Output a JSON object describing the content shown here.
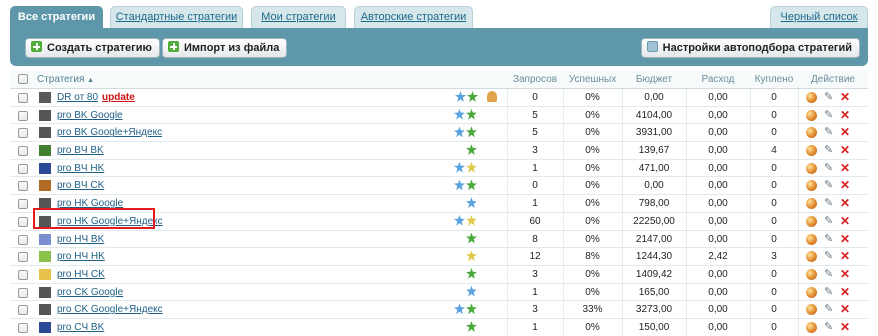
{
  "tabs": [
    {
      "label": "Все стратегии",
      "active": true
    },
    {
      "label": "Стандартные стратегии",
      "active": false
    },
    {
      "label": "Мои стратегии",
      "active": false
    },
    {
      "label": "Авторские стратегии",
      "active": false
    },
    {
      "label": "Черный список",
      "active": false
    }
  ],
  "toolbar": {
    "create_label": "Создать стратегию",
    "import_label": "Импорт из файла",
    "settings_label": "Настройки автоподбора стратегий"
  },
  "table": {
    "columns": {
      "strategy": "Стратегия",
      "requests": "Запросов",
      "success": "Успешных",
      "budget": "Бюджет",
      "expense": "Расход",
      "bought": "Куплено",
      "action": "Действие"
    },
    "sort_indicator": "▲",
    "rows": [
      {
        "color": "#5a5a5a",
        "name": "DR от 80",
        "extra": "update",
        "icons": [
          "b",
          "g",
          "person"
        ],
        "requests": "0",
        "success": "0%",
        "budget": "0,00",
        "expense": "0,00",
        "bought": "0"
      },
      {
        "color": "#555555",
        "name": "pro BK Google",
        "icons": [
          "b",
          "g"
        ],
        "requests": "5",
        "success": "0%",
        "budget": "4104,00",
        "expense": "0,00",
        "bought": "0"
      },
      {
        "color": "#555555",
        "name": "pro BK Google+Яндекс",
        "icons": [
          "b",
          "g"
        ],
        "requests": "5",
        "success": "0%",
        "budget": "3931,00",
        "expense": "0,00",
        "bought": "0"
      },
      {
        "color": "#3f7f2e",
        "name": "pro BЧ BK",
        "icons": [
          "g"
        ],
        "requests": "3",
        "success": "0%",
        "budget": "139,67",
        "expense": "0,00",
        "bought": "4"
      },
      {
        "color": "#2c4a96",
        "name": "pro BЧ HK",
        "icons": [
          "b",
          "y"
        ],
        "requests": "1",
        "success": "0%",
        "budget": "471,00",
        "expense": "0,00",
        "bought": "0"
      },
      {
        "color": "#b06c25",
        "name": "pro BЧ CK",
        "icons": [
          "b",
          "g"
        ],
        "requests": "0",
        "success": "0%",
        "budget": "0,00",
        "expense": "0,00",
        "bought": "0"
      },
      {
        "color": "#555555",
        "name": "pro HK Google",
        "icons": [
          "b"
        ],
        "requests": "1",
        "success": "0%",
        "budget": "798,00",
        "expense": "0,00",
        "bought": "0"
      },
      {
        "color": "#555555",
        "name": "pro HK Google+Яндекс",
        "icons": [
          "b",
          "y"
        ],
        "requests": "60",
        "success": "0%",
        "budget": "22250,00",
        "expense": "0,00",
        "bought": "0"
      },
      {
        "color": "#7a8fcf",
        "name": "pro HЧ BK",
        "icons": [
          "g"
        ],
        "requests": "8",
        "success": "0%",
        "budget": "2147,00",
        "expense": "0,00",
        "bought": "0"
      },
      {
        "color": "#8bc34a",
        "name": "pro HЧ HK",
        "icons": [
          "y"
        ],
        "requests": "12",
        "success": "8%",
        "budget": "1244,30",
        "expense": "2,42",
        "bought": "3"
      },
      {
        "color": "#e6c24a",
        "name": "pro HЧ CK",
        "icons": [
          "g"
        ],
        "requests": "3",
        "success": "0%",
        "budget": "1409,42",
        "expense": "0,00",
        "bought": "0"
      },
      {
        "color": "#555555",
        "name": "pro CK Google",
        "icons": [
          "b"
        ],
        "requests": "1",
        "success": "0%",
        "budget": "165,00",
        "expense": "0,00",
        "bought": "0"
      },
      {
        "color": "#555555",
        "name": "pro CK Google+Яндекс",
        "icons": [
          "b",
          "g"
        ],
        "requests": "3",
        "success": "33%",
        "budget": "3273,00",
        "expense": "0,00",
        "bought": "0"
      },
      {
        "color": "#2c4a96",
        "name": "pro CЧ BK",
        "icons": [
          "g"
        ],
        "requests": "1",
        "success": "0%",
        "budget": "150,00",
        "expense": "0,00",
        "bought": "0"
      }
    ]
  }
}
